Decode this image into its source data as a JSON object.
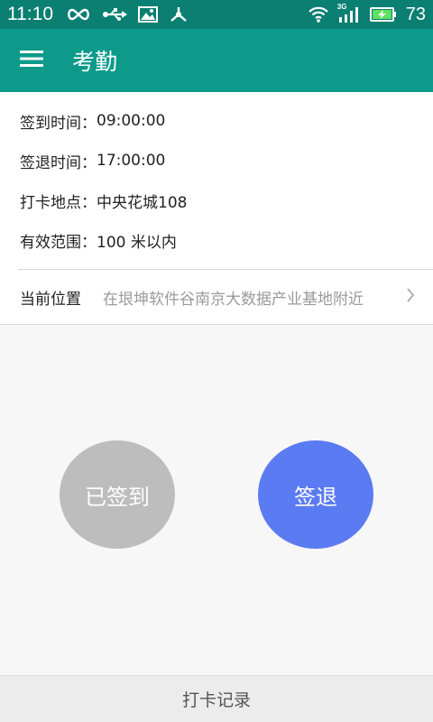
{
  "status_bar": {
    "time": "11:10",
    "battery_percent": "73",
    "network_label": "3G"
  },
  "app_bar": {
    "title": "考勤"
  },
  "info": {
    "sign_in_label": "签到时间：",
    "sign_in_value": "09:00:00",
    "sign_out_label": "签退时间：",
    "sign_out_value": "17:00:00",
    "location_label": "打卡地点：",
    "location_value": "中央花城108",
    "range_label": "有效范围：",
    "range_value": "100 米以内"
  },
  "current_position": {
    "label": "当前位置",
    "value": "在垠坤软件谷南京大数据产业基地附近"
  },
  "buttons": {
    "signed_in": "已签到",
    "sign_out": "签退"
  },
  "bottom": {
    "records": "打卡记录"
  },
  "colors": {
    "status_bar": "#0a7f72",
    "app_bar": "#0d9a8a",
    "signed_button": "#bdbdbd",
    "sign_out_button": "#5b7bf2"
  }
}
